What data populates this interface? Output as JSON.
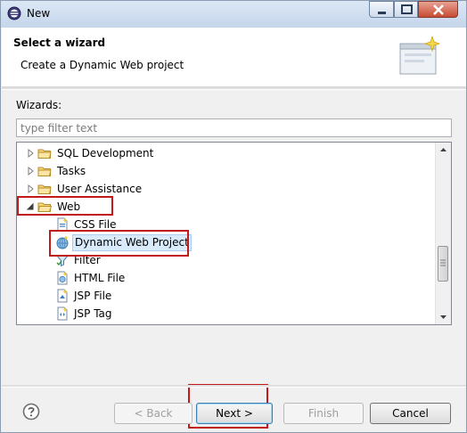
{
  "window": {
    "title": "New"
  },
  "header": {
    "title": "Select a wizard",
    "description": "Create a Dynamic Web project"
  },
  "wizards_label": "Wizards:",
  "filter": {
    "placeholder": "type filter text",
    "value": ""
  },
  "tree": {
    "items": [
      {
        "label": "SQL Development",
        "type": "folder",
        "expanded": false,
        "level": 0
      },
      {
        "label": "Tasks",
        "type": "folder",
        "expanded": false,
        "level": 0
      },
      {
        "label": "User Assistance",
        "type": "folder",
        "expanded": false,
        "level": 0
      },
      {
        "label": "Web",
        "type": "folder",
        "expanded": true,
        "level": 0
      },
      {
        "label": "CSS File",
        "type": "file",
        "icon": "css-file-icon",
        "level": 1
      },
      {
        "label": "Dynamic Web Project",
        "type": "project",
        "icon": "web-project-icon",
        "level": 1,
        "selected": true
      },
      {
        "label": "Filter",
        "type": "file",
        "icon": "filter-icon",
        "level": 1
      },
      {
        "label": "HTML File",
        "type": "file",
        "icon": "html-file-icon",
        "level": 1
      },
      {
        "label": "JSP File",
        "type": "file",
        "icon": "jsp-file-icon",
        "level": 1
      },
      {
        "label": "JSP Tag",
        "type": "file",
        "icon": "jsp-tag-icon",
        "level": 1
      }
    ]
  },
  "buttons": {
    "back": "< Back",
    "next": "Next >",
    "finish": "Finish",
    "cancel": "Cancel"
  },
  "colors": {
    "annotation": "#c21a1a",
    "selection": "#d9ebfb"
  }
}
